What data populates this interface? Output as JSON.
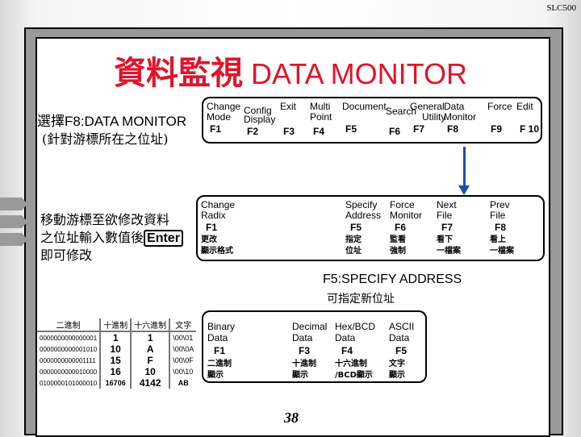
{
  "corner_label": "SLC500",
  "title": {
    "zh": "資料監視",
    "en": "DATA MONITOR"
  },
  "select_text": {
    "line1": "選擇F8:DATA MONITOR",
    "line2": "(針對游標所在之位址)"
  },
  "top_menu": [
    {
      "l1": "Change",
      "l2": "Mode",
      "key": "F1"
    },
    {
      "l1": "Config",
      "l2": "Display",
      "key": "F2"
    },
    {
      "l1": "Exit",
      "l2": "",
      "key": "F3"
    },
    {
      "l1": "Multi",
      "l2": "Point",
      "key": "F4"
    },
    {
      "l1": "Document",
      "l2": "",
      "key": "F5"
    },
    {
      "l1": "Search",
      "l2": "",
      "key": "F6"
    },
    {
      "l1": "General",
      "l2": "Utility",
      "key": "F7"
    },
    {
      "l1": "Data",
      "l2": "Monitor",
      "key": "F8"
    },
    {
      "l1": "Force",
      "l2": "",
      "key": "F9"
    },
    {
      "l1": "Edit",
      "l2": "",
      "key": "F 10"
    }
  ],
  "instructions": {
    "line1": "移動游標至欲修改資料",
    "line2": "之位址輸入數值後",
    "enter": "Enter",
    "line3": "即可修改"
  },
  "monitor_menu": [
    {
      "l1": "Change",
      "l2": "Radix",
      "key": "F1",
      "zh1": "更改",
      "zh2": "顯示格式"
    },
    {
      "l1": "Specify",
      "l2": "Address",
      "key": "F5",
      "zh1": "指定",
      "zh2": "位址"
    },
    {
      "l1": "Force",
      "l2": "Monitor",
      "key": "F6",
      "zh1": "監看",
      "zh2": "強制"
    },
    {
      "l1": "Next",
      "l2": "File",
      "key": "F7",
      "zh1": "看下",
      "zh2": "一檔案"
    },
    {
      "l1": "Prev",
      "l2": "File",
      "key": "F8",
      "zh1": "看上",
      "zh2": "一檔案"
    }
  ],
  "specify_caption": {
    "en": "F5:SPECIFY ADDRESS",
    "zh": "可指定新位址"
  },
  "radix_table": {
    "headers": [
      "二進制",
      "十進制",
      "十六進制",
      "文字"
    ],
    "rows": [
      [
        "0000000000000001",
        "1",
        "1",
        "\\00\\01"
      ],
      [
        "0000000000001010",
        "10",
        "A",
        "\\00\\0A"
      ],
      [
        "0000000000001111",
        "15",
        "F",
        "\\00\\0F"
      ],
      [
        "0000000000010000",
        "16",
        "10",
        "\\00\\10"
      ],
      [
        "0100000101000010",
        "16706",
        "4142",
        "AB"
      ]
    ]
  },
  "radix_menu": [
    {
      "l1": "Binary",
      "l2": "Data",
      "key": "F1",
      "zh1": "二進制",
      "zh2": "顯示"
    },
    {
      "l1": "Decimal",
      "l2": "Data",
      "key": "F3",
      "zh1": "十進制",
      "zh2": "顯示"
    },
    {
      "l1": "Hex/BCD",
      "l2": "Data",
      "key": "F4",
      "zh1": "十六進制",
      "zh2": "/BCD顯示"
    },
    {
      "l1": "ASCII",
      "l2": "Data",
      "key": "F5",
      "zh1": "文字",
      "zh2": "顯示"
    }
  ],
  "page_number": "38",
  "colors": {
    "title": "#e0142c",
    "arrow": "#1a4fb0",
    "frame": "#999999"
  }
}
